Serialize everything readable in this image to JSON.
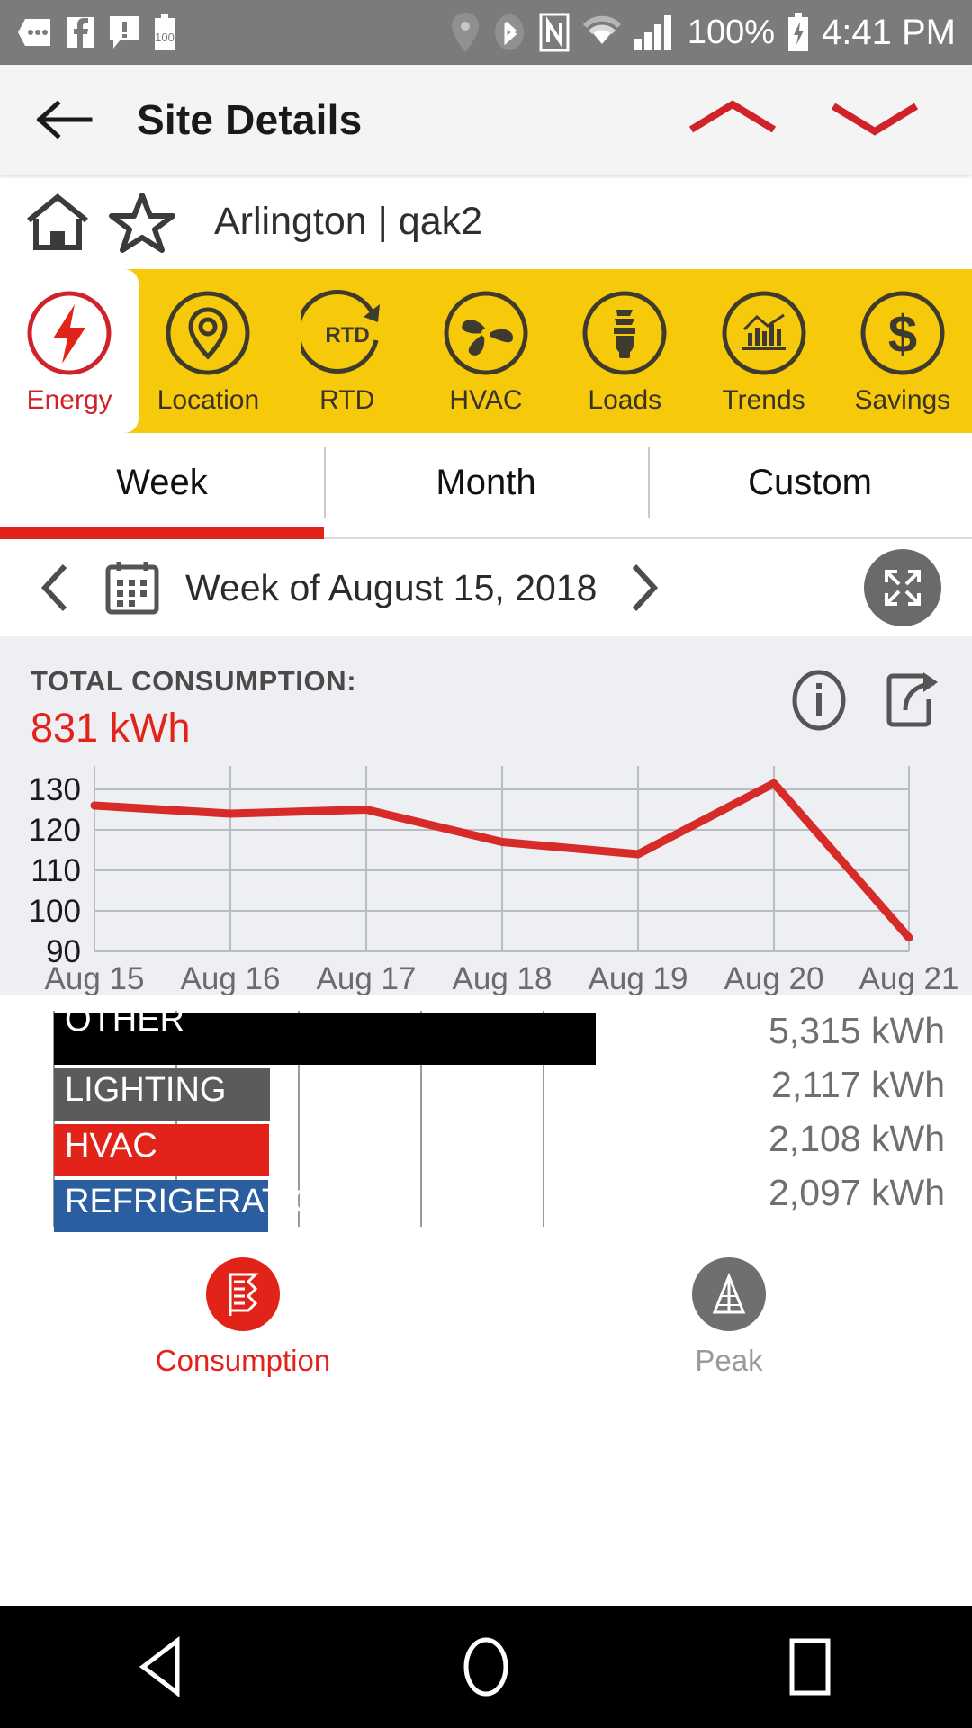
{
  "status_bar": {
    "icons": [
      "messages-icon",
      "facebook-icon",
      "alert-icon",
      "battery-100-icon",
      "location-icon",
      "bluetooth-icon",
      "nfc-icon",
      "wifi-icon",
      "signal-icon"
    ],
    "battery_percent": "100%",
    "charging_icon": "battery-charging-icon",
    "time": "4:41 PM",
    "background": "#7b7b7b"
  },
  "app_bar": {
    "back_icon": "back-arrow-icon",
    "title": "Site Details",
    "collapse_icon": "chevron-up-icon",
    "expand_icon": "chevron-down-icon",
    "accent": "#D0222B"
  },
  "site_row": {
    "home_icon": "home-icon",
    "favorite_icon": "star-outline-icon",
    "name": "Arlington | qak2"
  },
  "category_nav": {
    "background": "#F6C90B",
    "active_index": 0,
    "items": [
      {
        "label": "Energy",
        "icon": "energy-bolt-icon"
      },
      {
        "label": "Location",
        "icon": "location-pin-icon"
      },
      {
        "label": "RTD",
        "icon": "rtd-refresh-icon"
      },
      {
        "label": "HVAC",
        "icon": "fan-icon"
      },
      {
        "label": "Loads",
        "icon": "lightbulb-icon"
      },
      {
        "label": "Trends",
        "icon": "bar-chart-icon"
      },
      {
        "label": "Savings",
        "icon": "dollar-icon"
      }
    ]
  },
  "period_tabs": {
    "active_index": 0,
    "indicator_color": "#E2231A",
    "items": [
      {
        "label": "Week"
      },
      {
        "label": "Month"
      },
      {
        "label": "Custom"
      }
    ]
  },
  "date_nav": {
    "prev_icon": "chevron-left-icon",
    "calendar_icon": "calendar-icon",
    "label": "Week of August 15, 2018",
    "next_icon": "chevron-right-icon",
    "fullscreen_icon": "fullscreen-expand-icon"
  },
  "consumption_card": {
    "title": "TOTAL CONSUMPTION:",
    "value": "831 kWh",
    "value_color": "#E2231A",
    "info_icon": "info-icon",
    "share_icon": "share-export-icon",
    "background": "#edeff2"
  },
  "breakdown": {
    "values": [
      "5,315 kWh",
      "2,117 kWh",
      "2,108 kWh",
      "2,097 kWh"
    ]
  },
  "mode_toggle": {
    "active_index": 0,
    "items": [
      {
        "label": "Consumption",
        "icon": "consumption-report-icon",
        "color": "#E2231A"
      },
      {
        "label": "Peak",
        "icon": "peak-icon",
        "color": "#6f6f6f"
      }
    ]
  },
  "system_nav": {
    "back_icon": "nav-back-triangle-icon",
    "home_icon": "nav-home-circle-icon",
    "recents_icon": "nav-recents-square-icon"
  },
  "chart_data": [
    {
      "type": "line",
      "title": "TOTAL CONSUMPTION:",
      "xlabel": "",
      "ylabel": "",
      "categories": [
        "Aug 15",
        "Aug 16",
        "Aug 17",
        "Aug 18",
        "Aug 19",
        "Aug 20",
        "Aug 21"
      ],
      "values": [
        126,
        124,
        125,
        117,
        114,
        131.5,
        93.5
      ],
      "ylim": [
        90,
        134
      ],
      "yticks": [
        90,
        100,
        110,
        120,
        130
      ],
      "grid": true,
      "line_color": "#D62B28",
      "legend": "none"
    },
    {
      "type": "bar",
      "orientation": "horizontal",
      "categories": [
        "OTHER",
        "LIGHTING",
        "HVAC",
        "REFRIGERATION"
      ],
      "values": [
        5315,
        2117,
        2108,
        2097
      ],
      "value_labels": [
        "5,315 kWh",
        "2,117 kWh",
        "2,108 kWh",
        "2,097 kWh"
      ],
      "colors": [
        "#000000",
        "#5b5b5b",
        "#E2231A",
        "#2B5EA0"
      ],
      "xlim": [
        0,
        9000
      ],
      "grid": true,
      "legend": "none"
    }
  ]
}
